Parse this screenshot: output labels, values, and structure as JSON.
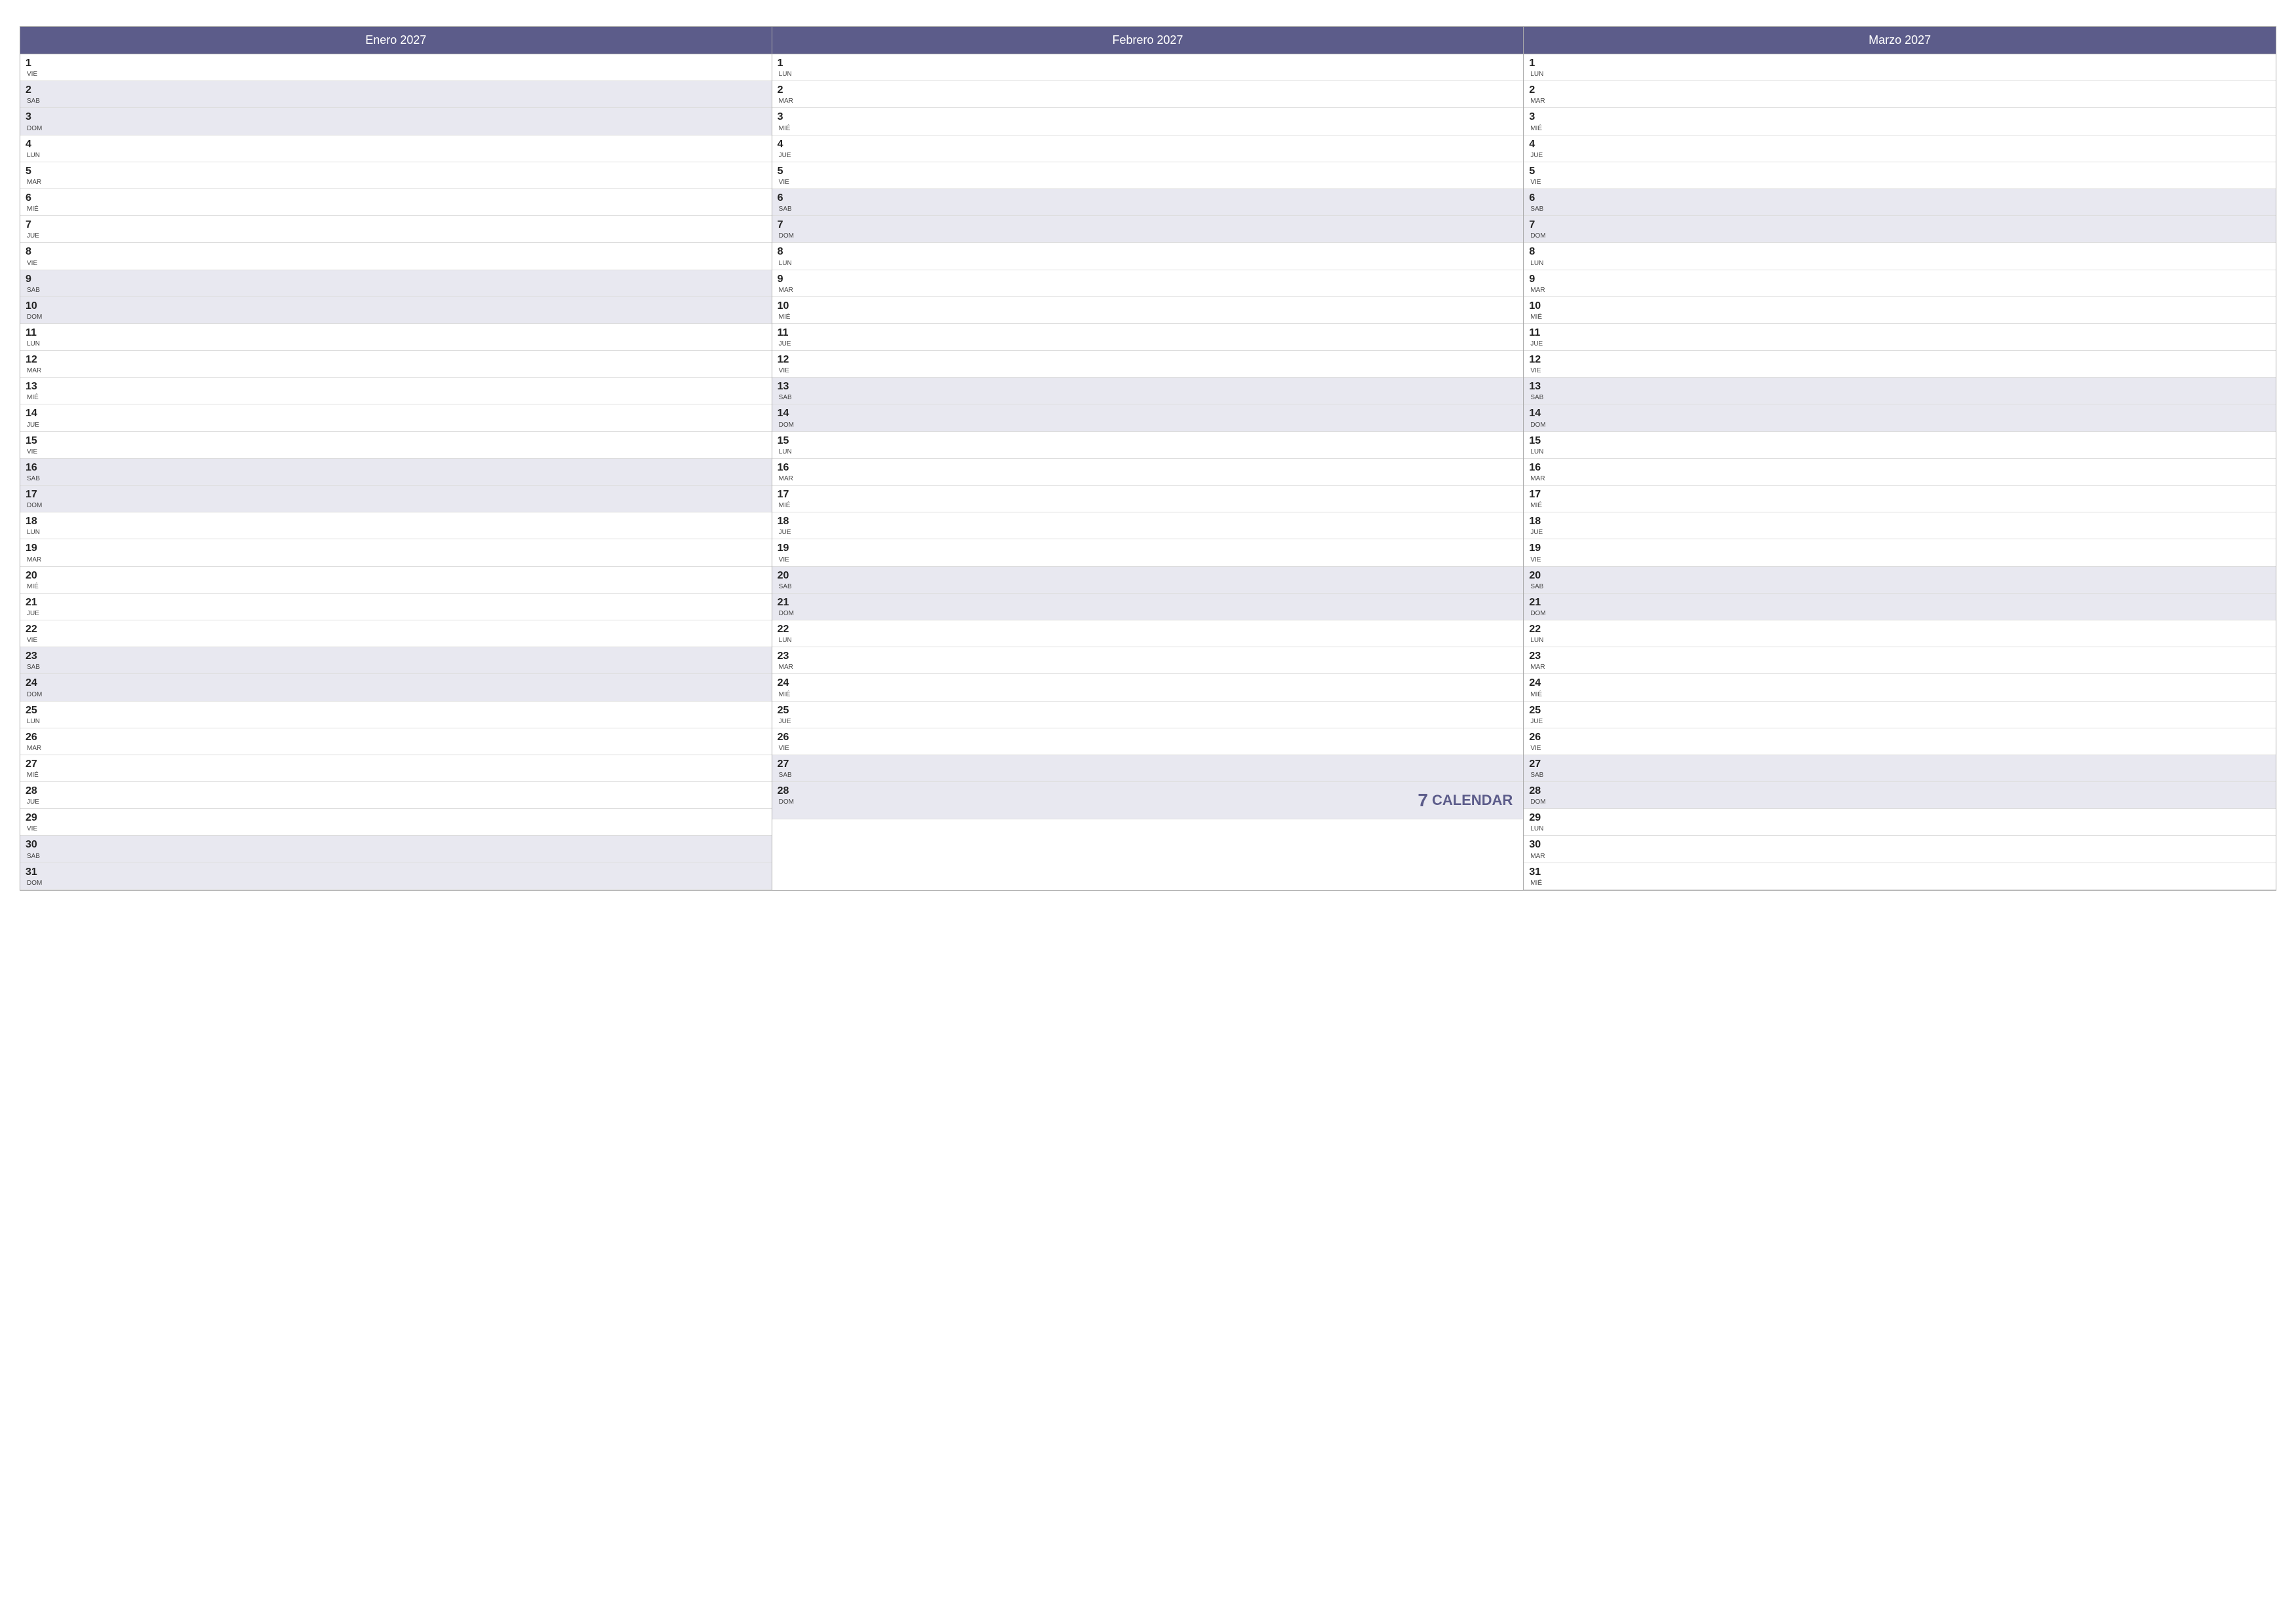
{
  "months": [
    {
      "id": "enero",
      "label": "Enero 2027",
      "days": [
        {
          "num": "1",
          "name": "VIE",
          "type": "weekday"
        },
        {
          "num": "2",
          "name": "SAB",
          "type": "weekend"
        },
        {
          "num": "3",
          "name": "DOM",
          "type": "weekend"
        },
        {
          "num": "4",
          "name": "LUN",
          "type": "weekday"
        },
        {
          "num": "5",
          "name": "MAR",
          "type": "weekday"
        },
        {
          "num": "6",
          "name": "MIÉ",
          "type": "weekday"
        },
        {
          "num": "7",
          "name": "JUE",
          "type": "weekday"
        },
        {
          "num": "8",
          "name": "VIE",
          "type": "weekday"
        },
        {
          "num": "9",
          "name": "SAB",
          "type": "weekend"
        },
        {
          "num": "10",
          "name": "DOM",
          "type": "weekend"
        },
        {
          "num": "11",
          "name": "LUN",
          "type": "weekday"
        },
        {
          "num": "12",
          "name": "MAR",
          "type": "weekday"
        },
        {
          "num": "13",
          "name": "MIÉ",
          "type": "weekday"
        },
        {
          "num": "14",
          "name": "JUE",
          "type": "weekday"
        },
        {
          "num": "15",
          "name": "VIE",
          "type": "weekday"
        },
        {
          "num": "16",
          "name": "SAB",
          "type": "weekend"
        },
        {
          "num": "17",
          "name": "DOM",
          "type": "weekend"
        },
        {
          "num": "18",
          "name": "LUN",
          "type": "weekday"
        },
        {
          "num": "19",
          "name": "MAR",
          "type": "weekday"
        },
        {
          "num": "20",
          "name": "MIÉ",
          "type": "weekday"
        },
        {
          "num": "21",
          "name": "JUE",
          "type": "weekday"
        },
        {
          "num": "22",
          "name": "VIE",
          "type": "weekday"
        },
        {
          "num": "23",
          "name": "SAB",
          "type": "weekend"
        },
        {
          "num": "24",
          "name": "DOM",
          "type": "weekend"
        },
        {
          "num": "25",
          "name": "LUN",
          "type": "weekday"
        },
        {
          "num": "26",
          "name": "MAR",
          "type": "weekday"
        },
        {
          "num": "27",
          "name": "MIÉ",
          "type": "weekday"
        },
        {
          "num": "28",
          "name": "JUE",
          "type": "weekday"
        },
        {
          "num": "29",
          "name": "VIE",
          "type": "weekday"
        },
        {
          "num": "30",
          "name": "SAB",
          "type": "weekend"
        },
        {
          "num": "31",
          "name": "DOM",
          "type": "weekend"
        }
      ]
    },
    {
      "id": "febrero",
      "label": "Febrero 2027",
      "days": [
        {
          "num": "1",
          "name": "LUN",
          "type": "weekday"
        },
        {
          "num": "2",
          "name": "MAR",
          "type": "weekday"
        },
        {
          "num": "3",
          "name": "MIÉ",
          "type": "weekday"
        },
        {
          "num": "4",
          "name": "JUE",
          "type": "weekday"
        },
        {
          "num": "5",
          "name": "VIE",
          "type": "weekday"
        },
        {
          "num": "6",
          "name": "SAB",
          "type": "weekend"
        },
        {
          "num": "7",
          "name": "DOM",
          "type": "weekend"
        },
        {
          "num": "8",
          "name": "LUN",
          "type": "weekday"
        },
        {
          "num": "9",
          "name": "MAR",
          "type": "weekday"
        },
        {
          "num": "10",
          "name": "MIÉ",
          "type": "weekday"
        },
        {
          "num": "11",
          "name": "JUE",
          "type": "weekday"
        },
        {
          "num": "12",
          "name": "VIE",
          "type": "weekday"
        },
        {
          "num": "13",
          "name": "SAB",
          "type": "weekend"
        },
        {
          "num": "14",
          "name": "DOM",
          "type": "weekend"
        },
        {
          "num": "15",
          "name": "LUN",
          "type": "weekday"
        },
        {
          "num": "16",
          "name": "MAR",
          "type": "weekday"
        },
        {
          "num": "17",
          "name": "MIÉ",
          "type": "weekday"
        },
        {
          "num": "18",
          "name": "JUE",
          "type": "weekday"
        },
        {
          "num": "19",
          "name": "VIE",
          "type": "weekday"
        },
        {
          "num": "20",
          "name": "SAB",
          "type": "weekend"
        },
        {
          "num": "21",
          "name": "DOM",
          "type": "weekend"
        },
        {
          "num": "22",
          "name": "LUN",
          "type": "weekday"
        },
        {
          "num": "23",
          "name": "MAR",
          "type": "weekday"
        },
        {
          "num": "24",
          "name": "MIÉ",
          "type": "weekday"
        },
        {
          "num": "25",
          "name": "JUE",
          "type": "weekday"
        },
        {
          "num": "26",
          "name": "VIE",
          "type": "weekday"
        },
        {
          "num": "27",
          "name": "SAB",
          "type": "weekend"
        },
        {
          "num": "28",
          "name": "DOM",
          "type": "weekend"
        }
      ]
    },
    {
      "id": "marzo",
      "label": "Marzo 2027",
      "days": [
        {
          "num": "1",
          "name": "LUN",
          "type": "weekday"
        },
        {
          "num": "2",
          "name": "MAR",
          "type": "weekday"
        },
        {
          "num": "3",
          "name": "MIÉ",
          "type": "weekday"
        },
        {
          "num": "4",
          "name": "JUE",
          "type": "weekday"
        },
        {
          "num": "5",
          "name": "VIE",
          "type": "weekday"
        },
        {
          "num": "6",
          "name": "SAB",
          "type": "weekend"
        },
        {
          "num": "7",
          "name": "DOM",
          "type": "weekend"
        },
        {
          "num": "8",
          "name": "LUN",
          "type": "weekday"
        },
        {
          "num": "9",
          "name": "MAR",
          "type": "weekday"
        },
        {
          "num": "10",
          "name": "MIÉ",
          "type": "weekday"
        },
        {
          "num": "11",
          "name": "JUE",
          "type": "weekday"
        },
        {
          "num": "12",
          "name": "VIE",
          "type": "weekday"
        },
        {
          "num": "13",
          "name": "SAB",
          "type": "weekend"
        },
        {
          "num": "14",
          "name": "DOM",
          "type": "weekend"
        },
        {
          "num": "15",
          "name": "LUN",
          "type": "weekday"
        },
        {
          "num": "16",
          "name": "MAR",
          "type": "weekday"
        },
        {
          "num": "17",
          "name": "MIÉ",
          "type": "weekday"
        },
        {
          "num": "18",
          "name": "JUE",
          "type": "weekday"
        },
        {
          "num": "19",
          "name": "VIE",
          "type": "weekday"
        },
        {
          "num": "20",
          "name": "SAB",
          "type": "weekend"
        },
        {
          "num": "21",
          "name": "DOM",
          "type": "weekend"
        },
        {
          "num": "22",
          "name": "LUN",
          "type": "weekday"
        },
        {
          "num": "23",
          "name": "MAR",
          "type": "weekday"
        },
        {
          "num": "24",
          "name": "MIÉ",
          "type": "weekday"
        },
        {
          "num": "25",
          "name": "JUE",
          "type": "weekday"
        },
        {
          "num": "26",
          "name": "VIE",
          "type": "weekday"
        },
        {
          "num": "27",
          "name": "SAB",
          "type": "weekend"
        },
        {
          "num": "28",
          "name": "DOM",
          "type": "weekend"
        },
        {
          "num": "29",
          "name": "LUN",
          "type": "weekday"
        },
        {
          "num": "30",
          "name": "MAR",
          "type": "weekday"
        },
        {
          "num": "31",
          "name": "MIÉ",
          "type": "weekday"
        }
      ]
    }
  ],
  "watermark": {
    "icon": "7",
    "label": "CALENDAR"
  }
}
